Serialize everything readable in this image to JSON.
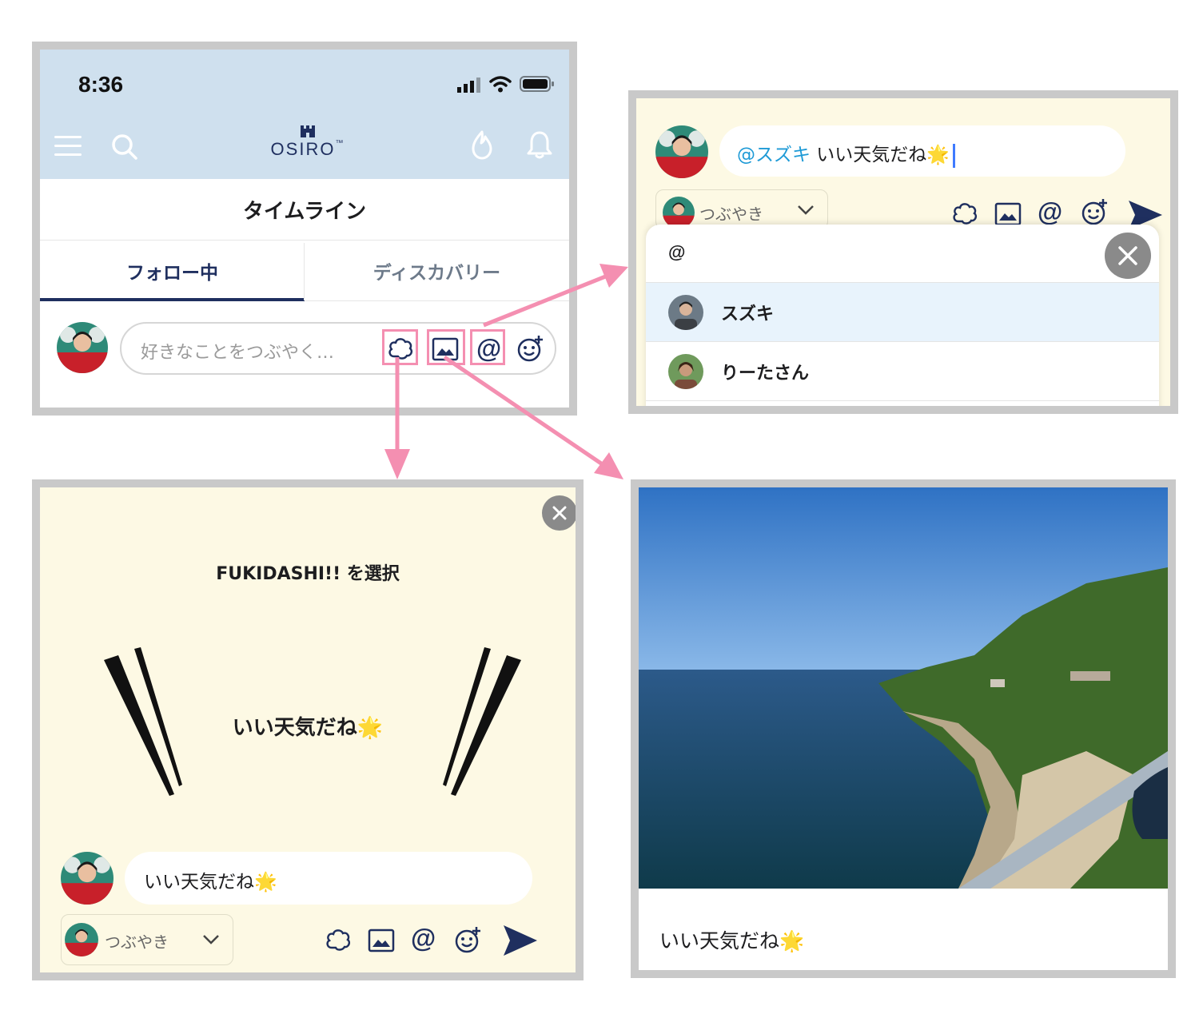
{
  "panel_timeline": {
    "status_time": "8:36",
    "logo_text": "OSIRO",
    "logo_tm": "™",
    "page_title": "タイムライン",
    "tabs": [
      {
        "label": "フォロー中",
        "active": true
      },
      {
        "label": "ディスカバリー",
        "active": false
      }
    ],
    "composer_placeholder": "好きなことをつぶやく…",
    "icons": [
      "menu-icon",
      "search-icon",
      "castle-icon",
      "flame-icon",
      "bell-icon",
      "fukidashi-icon",
      "image-icon",
      "mention-icon",
      "emoji-add-icon"
    ]
  },
  "panel_mention": {
    "input_mention": "@スズキ",
    "input_text": " いい天気だね",
    "input_emoji": "🌟",
    "post_type_label": "つぶやき",
    "dropdown_query": "@",
    "suggestions": [
      {
        "name": "スズキ",
        "highlighted": true
      },
      {
        "name": "りーたさん",
        "highlighted": false
      }
    ]
  },
  "panel_fukidashi": {
    "heading": "FUKIDASHI!! を選択",
    "bubble_text": "いい天気だね",
    "bubble_emoji": "🌟",
    "input_text": "いい天気だね",
    "input_emoji": "🌟",
    "post_type_label": "つぶやき"
  },
  "panel_image": {
    "caption_text": "いい天気だね",
    "caption_emoji": "🌟"
  },
  "colors": {
    "header_blue": "#cfe0ee",
    "cream": "#fdf9e4",
    "navy": "#1f2f5f",
    "mention_blue": "#1e9ad6",
    "highlight_pink": "#f48fb1",
    "suggestion_highlight": "#e8f3fc"
  }
}
